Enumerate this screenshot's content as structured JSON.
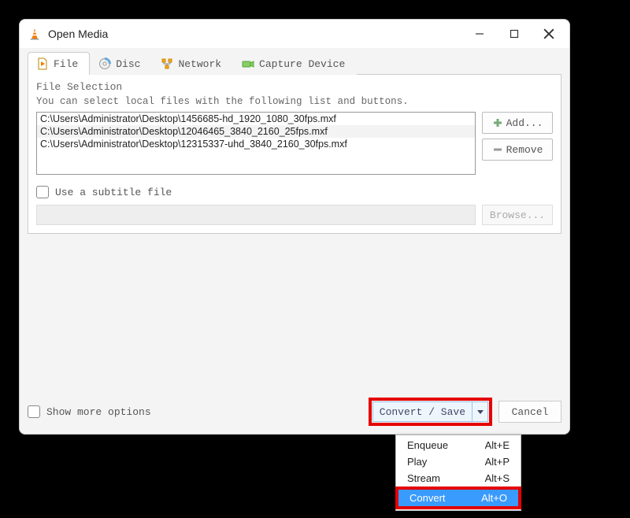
{
  "window": {
    "title": "Open Media"
  },
  "tabs": {
    "file": "File",
    "disc": "Disc",
    "network": "Network",
    "capture": "Capture Device"
  },
  "file_group": {
    "label": "File Selection",
    "desc": "You can select local files with the following list and buttons.",
    "files": [
      "C:\\Users\\Administrator\\Desktop\\1456685-hd_1920_1080_30fps.mxf",
      "C:\\Users\\Administrator\\Desktop\\12046465_3840_2160_25fps.mxf",
      "C:\\Users\\Administrator\\Desktop\\12315337-uhd_3840_2160_30fps.mxf"
    ],
    "add": "Add...",
    "remove": "Remove"
  },
  "subtitle": {
    "label": "Use a subtitle file",
    "browse": "Browse..."
  },
  "bottom": {
    "show_more": "Show more options",
    "convert_save": "Convert / Save",
    "cancel": "Cancel"
  },
  "menu": {
    "enqueue": {
      "label": "Enqueue",
      "shortcut": "Alt+E"
    },
    "play": {
      "label": "Play",
      "shortcut": "Alt+P"
    },
    "stream": {
      "label": "Stream",
      "shortcut": "Alt+S"
    },
    "convert": {
      "label": "Convert",
      "shortcut": "Alt+O"
    }
  }
}
